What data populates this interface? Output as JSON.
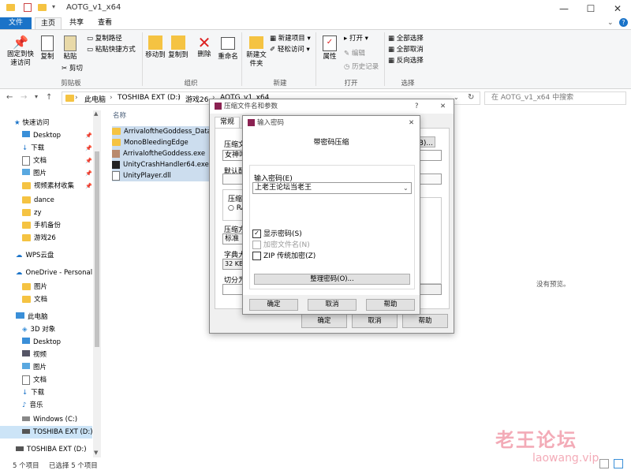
{
  "window": {
    "title": "AOTG_v1_x64"
  },
  "tabs": [
    "文件",
    "主页",
    "共享",
    "查看"
  ],
  "ribbon": {
    "clipboard": {
      "pin": "固定到快速访问",
      "copy": "复制",
      "paste": "粘贴",
      "copy_path": "复制路径",
      "paste_shortcut": "粘贴快捷方式",
      "cut": "剪切",
      "group": "剪贴板"
    },
    "organize": {
      "move_to": "移动到",
      "copy_to": "复制到",
      "delete": "删除",
      "rename": "重命名",
      "group": "组织"
    },
    "new": {
      "new_folder": "新建文件夹",
      "new_item": "新建项目",
      "easy_access": "轻松访问",
      "group": "新建"
    },
    "open": {
      "properties": "属性",
      "open": "打开",
      "edit": "编辑",
      "history": "历史记录",
      "group": "打开"
    },
    "select": {
      "select_all": "全部选择",
      "select_none": "全部取消",
      "invert": "反向选择",
      "group": "选择"
    }
  },
  "address": {
    "crumbs": [
      "此电脑",
      "TOSHIBA EXT (D:)",
      "游戏26",
      "AOTG_v1_x64"
    ],
    "search_placeholder": "在 AOTG_v1_x64 中搜索"
  },
  "nav": {
    "quick_access": "快速访问",
    "items": [
      "Desktop",
      "下载",
      "文档",
      "图片",
      "视频素材收集",
      "dance",
      "zy",
      "手机备份",
      "游戏26"
    ],
    "wps": "WPS云盘",
    "onedrive": "OneDrive - Personal",
    "onedrive_items": [
      "图片",
      "文档"
    ],
    "this_pc": "此电脑",
    "pc_items": [
      "3D 对象",
      "Desktop",
      "视频",
      "图片",
      "文档",
      "下载",
      "音乐",
      "Windows (C:)",
      "TOSHIBA EXT (D:)"
    ],
    "drive_bottom": "TOSHIBA EXT (D:)"
  },
  "files": {
    "header": "名称",
    "items": [
      "ArrivaloftheGoddess_Data",
      "MonoBleedingEdge",
      "ArrivaloftheGoddess.exe",
      "UnityCrashHandler64.exe",
      "UnityPlayer.dll"
    ]
  },
  "preview": {
    "none": "没有预览。"
  },
  "status": {
    "count": "5 个项目",
    "selected": "已选择 5 个项目"
  },
  "archive_dialog": {
    "title": "压缩文件名和参数",
    "help": "?",
    "tab_general": "常规",
    "label_archive": "压缩文",
    "archive_value": "女神叫",
    "label_default": "默认配",
    "label_format": "压缩",
    "radio_rar": "RA",
    "label_method": "压缩方",
    "method_value": "标准",
    "label_dict": "字典大",
    "dict_value": "32 KB",
    "label_split": "切分为",
    "browse": "浏览(B)...",
    "ok": "确定",
    "cancel": "取消",
    "help_btn": "帮助"
  },
  "pwd_dialog": {
    "title": "输入密码",
    "heading": "带密码压缩",
    "label": "输入密码(E)",
    "value": "上老王论坛当老王",
    "show_password": "显示密码(S)",
    "encrypt_names": "加密文件名(N)",
    "zip_legacy": "ZIP 传统加密(Z)",
    "organize": "整理密码(O)...",
    "ok": "确定",
    "cancel": "取消",
    "help": "帮助"
  },
  "watermark": {
    "cn": "老王论坛",
    "en": "laowang.vip"
  }
}
